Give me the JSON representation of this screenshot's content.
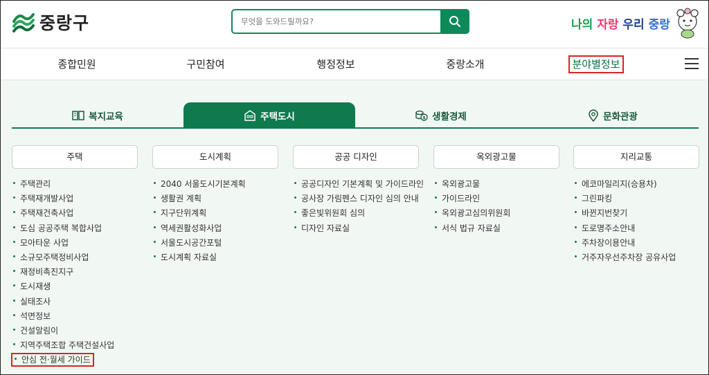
{
  "header": {
    "logo_text": "중랑구",
    "search_placeholder": "무엇을 도와드릴까요?",
    "slogan": {
      "part1": "나의",
      "part2": "자랑",
      "part3": "우리",
      "part4": "중랑"
    }
  },
  "nav": {
    "items": [
      "종합민원",
      "구민참여",
      "행정정보",
      "중랑소개",
      "분야별정보"
    ]
  },
  "tabs": [
    {
      "label": "복지교육",
      "icon": "book-icon"
    },
    {
      "label": "주택도시",
      "icon": "building-icon"
    },
    {
      "label": "생활경제",
      "icon": "coins-icon"
    },
    {
      "label": "문화관광",
      "icon": "map-pin-icon"
    }
  ],
  "columns": [
    {
      "title": "주택",
      "items": [
        "주택관리",
        "주택재개발사업",
        "주택재건축사업",
        "도심 공공주택 복합사업",
        "모아타운 사업",
        "소규모주택정비사업",
        "재정비촉진지구",
        "도시재생",
        "실태조사",
        "석면정보",
        "건설알림이",
        "지역주택조합 주택건설사업",
        "안심 전·월세 가이드"
      ]
    },
    {
      "title": "도시계획",
      "items": [
        "2040 서울도시기본계획",
        "생활권 계획",
        "지구단위계획",
        "역세권활성화사업",
        "서울도시공간포털",
        "도시계획 자료실"
      ]
    },
    {
      "title": "공공 디자인",
      "items": [
        "공공디자인 기본계획 및 가이드라인",
        "공사장 가림펜스 디자인 심의 안내",
        "좋은빛위원회 심의",
        "디자인 자료실"
      ]
    },
    {
      "title": "옥외광고물",
      "items": [
        "옥외광고물",
        "가이드라인",
        "옥외광고심의위원회",
        "서식 법규 자료실"
      ]
    },
    {
      "title": "지리교통",
      "items": [
        "에코마일리지(승용차)",
        "그린파킹",
        "바뀐지번찾기",
        "도로명주소안내",
        "주차장이용안내",
        "거주자우선주차장 공유사업"
      ]
    }
  ]
}
